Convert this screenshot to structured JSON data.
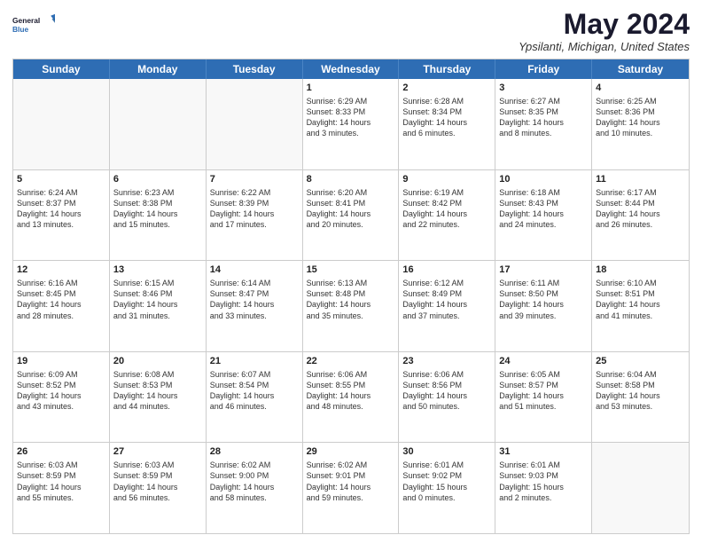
{
  "logo": {
    "line1": "General",
    "line2": "Blue"
  },
  "title": "May 2024",
  "location": "Ypsilanti, Michigan, United States",
  "header_days": [
    "Sunday",
    "Monday",
    "Tuesday",
    "Wednesday",
    "Thursday",
    "Friday",
    "Saturday"
  ],
  "weeks": [
    [
      {
        "day": "",
        "info": ""
      },
      {
        "day": "",
        "info": ""
      },
      {
        "day": "",
        "info": ""
      },
      {
        "day": "1",
        "info": "Sunrise: 6:29 AM\nSunset: 8:33 PM\nDaylight: 14 hours\nand 3 minutes."
      },
      {
        "day": "2",
        "info": "Sunrise: 6:28 AM\nSunset: 8:34 PM\nDaylight: 14 hours\nand 6 minutes."
      },
      {
        "day": "3",
        "info": "Sunrise: 6:27 AM\nSunset: 8:35 PM\nDaylight: 14 hours\nand 8 minutes."
      },
      {
        "day": "4",
        "info": "Sunrise: 6:25 AM\nSunset: 8:36 PM\nDaylight: 14 hours\nand 10 minutes."
      }
    ],
    [
      {
        "day": "5",
        "info": "Sunrise: 6:24 AM\nSunset: 8:37 PM\nDaylight: 14 hours\nand 13 minutes."
      },
      {
        "day": "6",
        "info": "Sunrise: 6:23 AM\nSunset: 8:38 PM\nDaylight: 14 hours\nand 15 minutes."
      },
      {
        "day": "7",
        "info": "Sunrise: 6:22 AM\nSunset: 8:39 PM\nDaylight: 14 hours\nand 17 minutes."
      },
      {
        "day": "8",
        "info": "Sunrise: 6:20 AM\nSunset: 8:41 PM\nDaylight: 14 hours\nand 20 minutes."
      },
      {
        "day": "9",
        "info": "Sunrise: 6:19 AM\nSunset: 8:42 PM\nDaylight: 14 hours\nand 22 minutes."
      },
      {
        "day": "10",
        "info": "Sunrise: 6:18 AM\nSunset: 8:43 PM\nDaylight: 14 hours\nand 24 minutes."
      },
      {
        "day": "11",
        "info": "Sunrise: 6:17 AM\nSunset: 8:44 PM\nDaylight: 14 hours\nand 26 minutes."
      }
    ],
    [
      {
        "day": "12",
        "info": "Sunrise: 6:16 AM\nSunset: 8:45 PM\nDaylight: 14 hours\nand 28 minutes."
      },
      {
        "day": "13",
        "info": "Sunrise: 6:15 AM\nSunset: 8:46 PM\nDaylight: 14 hours\nand 31 minutes."
      },
      {
        "day": "14",
        "info": "Sunrise: 6:14 AM\nSunset: 8:47 PM\nDaylight: 14 hours\nand 33 minutes."
      },
      {
        "day": "15",
        "info": "Sunrise: 6:13 AM\nSunset: 8:48 PM\nDaylight: 14 hours\nand 35 minutes."
      },
      {
        "day": "16",
        "info": "Sunrise: 6:12 AM\nSunset: 8:49 PM\nDaylight: 14 hours\nand 37 minutes."
      },
      {
        "day": "17",
        "info": "Sunrise: 6:11 AM\nSunset: 8:50 PM\nDaylight: 14 hours\nand 39 minutes."
      },
      {
        "day": "18",
        "info": "Sunrise: 6:10 AM\nSunset: 8:51 PM\nDaylight: 14 hours\nand 41 minutes."
      }
    ],
    [
      {
        "day": "19",
        "info": "Sunrise: 6:09 AM\nSunset: 8:52 PM\nDaylight: 14 hours\nand 43 minutes."
      },
      {
        "day": "20",
        "info": "Sunrise: 6:08 AM\nSunset: 8:53 PM\nDaylight: 14 hours\nand 44 minutes."
      },
      {
        "day": "21",
        "info": "Sunrise: 6:07 AM\nSunset: 8:54 PM\nDaylight: 14 hours\nand 46 minutes."
      },
      {
        "day": "22",
        "info": "Sunrise: 6:06 AM\nSunset: 8:55 PM\nDaylight: 14 hours\nand 48 minutes."
      },
      {
        "day": "23",
        "info": "Sunrise: 6:06 AM\nSunset: 8:56 PM\nDaylight: 14 hours\nand 50 minutes."
      },
      {
        "day": "24",
        "info": "Sunrise: 6:05 AM\nSunset: 8:57 PM\nDaylight: 14 hours\nand 51 minutes."
      },
      {
        "day": "25",
        "info": "Sunrise: 6:04 AM\nSunset: 8:58 PM\nDaylight: 14 hours\nand 53 minutes."
      }
    ],
    [
      {
        "day": "26",
        "info": "Sunrise: 6:03 AM\nSunset: 8:59 PM\nDaylight: 14 hours\nand 55 minutes."
      },
      {
        "day": "27",
        "info": "Sunrise: 6:03 AM\nSunset: 8:59 PM\nDaylight: 14 hours\nand 56 minutes."
      },
      {
        "day": "28",
        "info": "Sunrise: 6:02 AM\nSunset: 9:00 PM\nDaylight: 14 hours\nand 58 minutes."
      },
      {
        "day": "29",
        "info": "Sunrise: 6:02 AM\nSunset: 9:01 PM\nDaylight: 14 hours\nand 59 minutes."
      },
      {
        "day": "30",
        "info": "Sunrise: 6:01 AM\nSunset: 9:02 PM\nDaylight: 15 hours\nand 0 minutes."
      },
      {
        "day": "31",
        "info": "Sunrise: 6:01 AM\nSunset: 9:03 PM\nDaylight: 15 hours\nand 2 minutes."
      },
      {
        "day": "",
        "info": ""
      }
    ]
  ]
}
